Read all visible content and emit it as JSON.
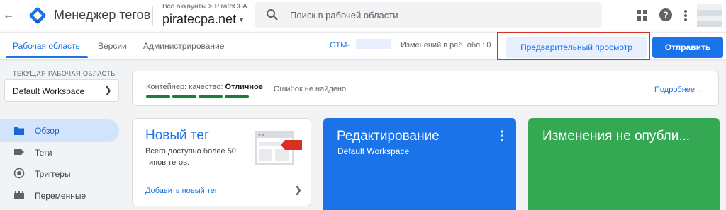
{
  "header": {
    "back_icon": "arrow-left-icon",
    "logo_icon": "gtm-logo-icon",
    "app_title": "Менеджер тегов",
    "breadcrumb": "Все аккаунты > PirateCPA",
    "container": "piratecpa.net",
    "search_placeholder": "Поиск в рабочей области",
    "icons": [
      "apps-grid-icon",
      "help-icon",
      "more-vert-icon",
      "avatar"
    ],
    "help_glyph": "?"
  },
  "nav": {
    "tabs": [
      {
        "label": "Рабочая область",
        "active": true
      },
      {
        "label": "Версии",
        "active": false
      },
      {
        "label": "Администрирование",
        "active": false
      }
    ],
    "gtm_id": "GTM-",
    "changes_label": "Изменений в раб. обл.: 0",
    "preview_label": "Предварительный просмотр",
    "submit_label": "Отправить"
  },
  "sidebar": {
    "workspace_label": "ТЕКУЩАЯ РАБОЧАЯ ОБЛАСТЬ",
    "workspace_name": "Default Workspace",
    "items": [
      {
        "label": "Обзор",
        "icon": "overview-folder-icon",
        "active": true
      },
      {
        "label": "Теги",
        "icon": "tag-icon",
        "active": false
      },
      {
        "label": "Триггеры",
        "icon": "trigger-icon",
        "active": false
      },
      {
        "label": "Переменные",
        "icon": "variables-icon",
        "active": false
      }
    ]
  },
  "quality": {
    "label": "Контейнер: качество: ",
    "value": "Отличное",
    "status": "Ошибок не найдено.",
    "link": "Подробнее...",
    "bar_color": "#188038",
    "bars": 4
  },
  "new_tag": {
    "title": "Новый тег",
    "description": "Всего доступно более 50 типов тегов.",
    "link": "Добавить новый тег"
  },
  "edit_card": {
    "title": "Редактирование",
    "subtitle": "Default Workspace",
    "color": "#1a73e8"
  },
  "changes_card": {
    "title": "Изменения не опубли...",
    "color": "#34a853"
  }
}
